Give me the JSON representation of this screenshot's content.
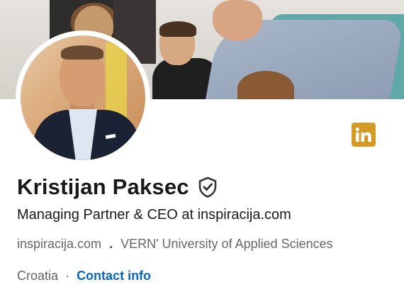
{
  "profile": {
    "name": "Kristijan Paksec",
    "headline": "Managing Partner & CEO at inspiracija.com",
    "company": "inspiracija.com",
    "meta_separator": ".",
    "school": "VERN' University of Applied Sciences",
    "location": "Croatia",
    "location_separator": "·",
    "contact_label": "Contact info"
  },
  "icons": {
    "verified": "verified-shield-icon",
    "linkedin": "linkedin-logo-icon"
  },
  "colors": {
    "linkedin_badge": "#d39a26",
    "link": "#0a66c2",
    "secondary_text": "#666666"
  }
}
